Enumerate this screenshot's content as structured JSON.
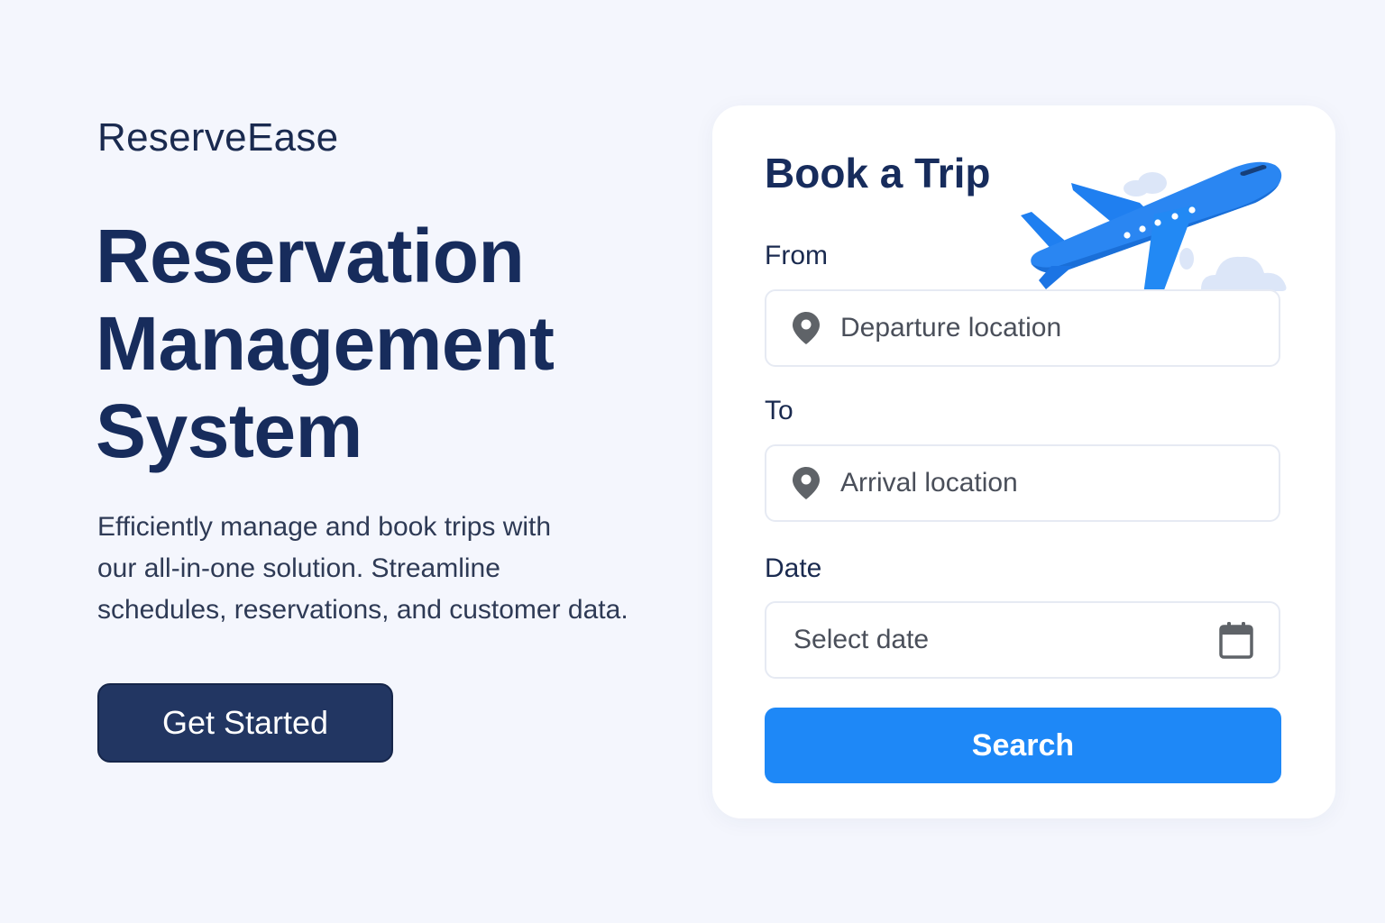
{
  "brand": {
    "name": "ReserveEase"
  },
  "hero": {
    "title_lines": [
      "Reservation",
      "Management",
      "System"
    ],
    "description_lines": [
      "Efficiently manage and book trips with",
      "our all-in-one solution. Streamline",
      "schedules, reservations, and customer data."
    ],
    "cta_label": "Get Started"
  },
  "booking": {
    "title": "Book a Trip",
    "from": {
      "label": "From",
      "placeholder": "Departure location",
      "icon": "map-pin-icon"
    },
    "to": {
      "label": "To",
      "placeholder": "Arrival location",
      "icon": "map-pin-icon"
    },
    "date": {
      "label": "Date",
      "placeholder": "Select date",
      "icon": "calendar-icon"
    },
    "search_label": "Search",
    "illustration": "airplane-with-clouds"
  },
  "colors": {
    "background": "#f4f6fd",
    "primary_dark": "#223662",
    "accent_blue": "#1e88f7",
    "heading": "#172c5c"
  }
}
